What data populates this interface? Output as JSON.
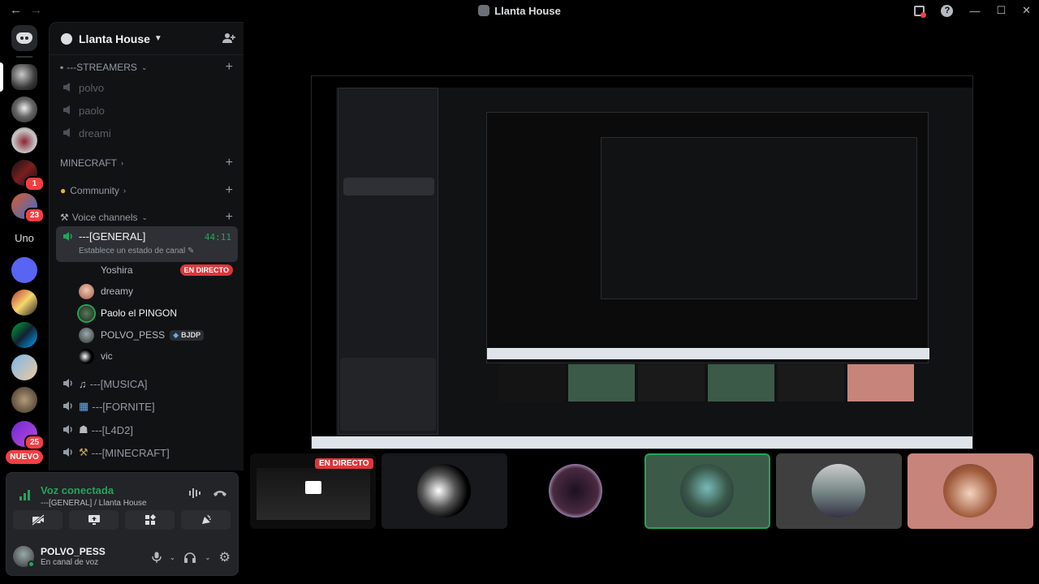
{
  "window": {
    "title": "Llanta House",
    "back": "←",
    "forward": "→",
    "help": "?",
    "minimize": "—",
    "maximize": "☐",
    "close": "✕"
  },
  "rail": {
    "text_server": "Uno",
    "badges": [
      "1",
      "23",
      "25"
    ],
    "nuevo": "NUEVO"
  },
  "server": {
    "name": "Llanta House",
    "categories": {
      "streamers": "---STREAMERS",
      "minecraft": "MINECRAFT",
      "community": "Community",
      "voice": "Voice channels"
    },
    "stream_channels": [
      "polvo",
      "paolo",
      "dreami"
    ],
    "active_channel": {
      "name": "---[GENERAL]",
      "timer": "44:11",
      "status": "Establece un estado de canal"
    },
    "voice_users": [
      {
        "name": "Yoshira",
        "live": "EN DIRECTO"
      },
      {
        "name": "dreamy"
      },
      {
        "name": "Paolo el PINGON"
      },
      {
        "name": "POLVO_PESS",
        "tag": "BJDP"
      },
      {
        "name": "vic"
      }
    ],
    "voice_channels": [
      "---[MUSICA]",
      "---[FORNITE]",
      "---[L4D2]",
      "---[MINECRAFT]"
    ]
  },
  "voice_panel": {
    "title": "Voz conectada",
    "subtitle": "---[GENERAL] / Llanta House",
    "user": "POLVO_PESS",
    "user_status": "En canal de voz"
  },
  "stage": {
    "live_label": "EN DIRECTO"
  },
  "colors": {
    "accent_green": "#23a55a",
    "live_red": "#da373c",
    "badge_red": "#f23f43"
  }
}
